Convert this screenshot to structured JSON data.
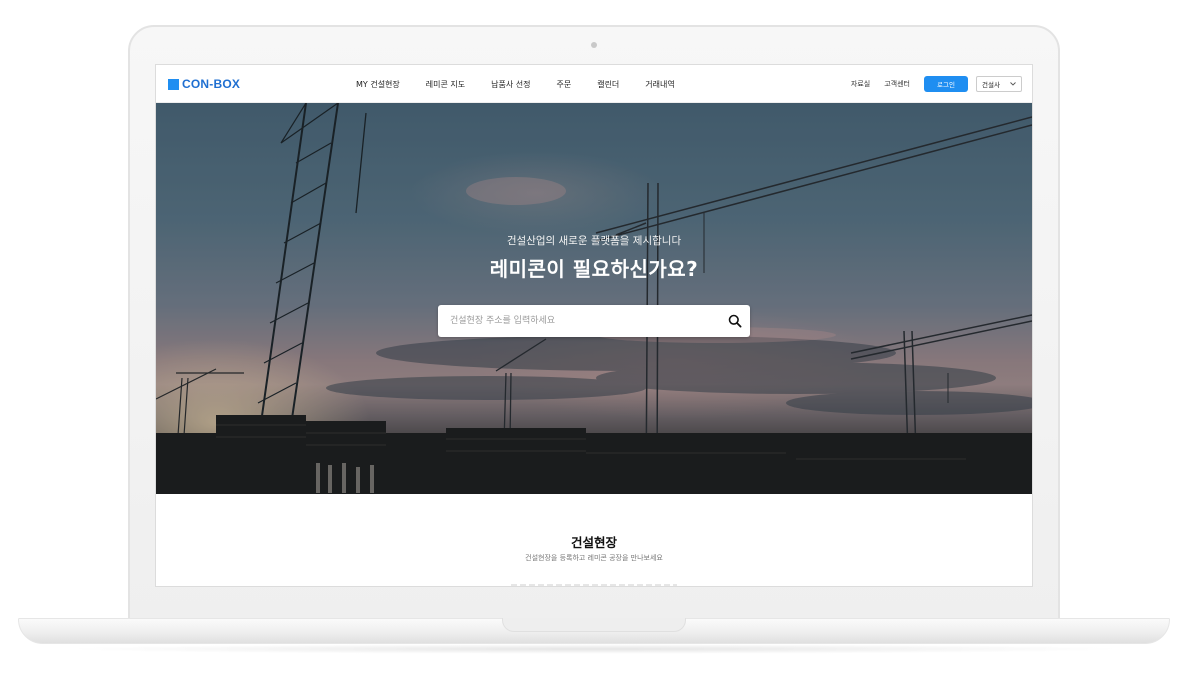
{
  "nav": {
    "logo_text": "CON-BOX",
    "menu": [
      {
        "label": "MY 건설현장"
      },
      {
        "label": "레미콘 지도"
      },
      {
        "label": "납품사 선정"
      },
      {
        "label": "주문"
      },
      {
        "label": "캘린더"
      },
      {
        "label": "거래내역"
      }
    ],
    "links": [
      {
        "label": "자료실"
      },
      {
        "label": "고객센터"
      }
    ],
    "login_label": "로그인",
    "role_select": {
      "selected": "건설사"
    }
  },
  "hero": {
    "subtitle": "건설산업의 새로운 플랫폼을 제시합니다",
    "title": "레미콘이 필요하신가요?",
    "search": {
      "placeholder": "건설현장 주소를 입력하세요",
      "value": ""
    }
  },
  "section": {
    "title": "건설현장",
    "subtitle": "건설현장을 등록하고 레미콘 공장을 만나보세요"
  },
  "colors": {
    "accent": "#1f8ef1",
    "logo_text": "#1f6fd1"
  },
  "icons": {
    "search": "magnifier-icon",
    "select": "chevron-down-icon"
  }
}
